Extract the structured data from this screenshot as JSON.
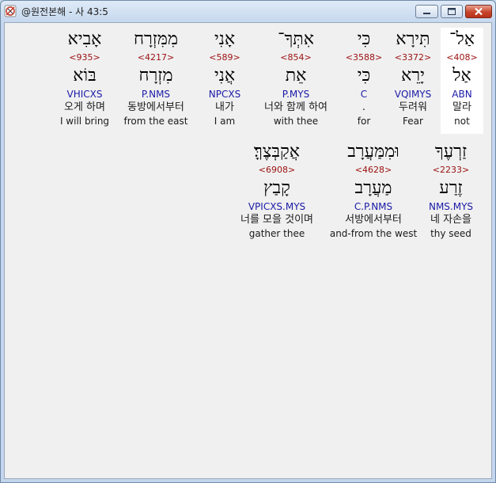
{
  "window": {
    "title": "@원전본해 - 사 43:5",
    "buttons": {
      "minimize": "minimize-icon",
      "maximize": "maximize-icon",
      "close": "close-icon"
    }
  },
  "verse": {
    "words": [
      {
        "hebrew": "אַל־",
        "strong": "<408>",
        "lemma": "אַל",
        "morph": "ABN",
        "korean": "말라",
        "english": "not"
      },
      {
        "hebrew": "תִּירָא",
        "strong": "<3372>",
        "lemma": "יָרֵא",
        "morph": "VQIMYS",
        "korean": "두려워",
        "english": "Fear"
      },
      {
        "hebrew": "כִּי",
        "strong": "<3588>",
        "lemma": "כִּי",
        "morph": "C",
        "korean": ".",
        "english": "for"
      },
      {
        "hebrew": "אִתְּךָ־",
        "strong": "<854>",
        "lemma": "אֵת",
        "morph": "P.MYS",
        "korean": "너와 함께 하여",
        "english": "with thee"
      },
      {
        "hebrew": "אָנִי",
        "strong": "<589>",
        "lemma": "אֲנִי",
        "morph": "NPCXS",
        "korean": "내가",
        "english": "I am"
      },
      {
        "hebrew": "מִמִּזְרָח",
        "strong": "<4217>",
        "lemma": "מִזְרָח",
        "morph": "P.NMS",
        "korean": "동방에서부터",
        "english": "from the east"
      },
      {
        "hebrew": "אָבִיא",
        "strong": "<935>",
        "lemma": "בּוֹא",
        "morph": "VHICXS",
        "korean": "오게 하며",
        "english": "I will bring"
      },
      {
        "hebrew": "זַרְעֶךָ",
        "strong": "<2233>",
        "lemma": "זֶרַע",
        "morph": "NMS.MYS",
        "korean": "네 자손을",
        "english": "thy seed"
      },
      {
        "hebrew": "וּמִמַּעֲרָב",
        "strong": "<4628>",
        "lemma": "מַעֲרָב",
        "morph": "C.P.NMS",
        "korean": "서방에서부터",
        "english": "and-from the west"
      },
      {
        "hebrew": "אֲקַבְּצֶךָּ׃",
        "strong": "<6908>",
        "lemma": "קָבַץ",
        "morph": "VPICXS.MYS",
        "korean": "너를 모을 것이며",
        "english": "gather thee"
      }
    ]
  }
}
